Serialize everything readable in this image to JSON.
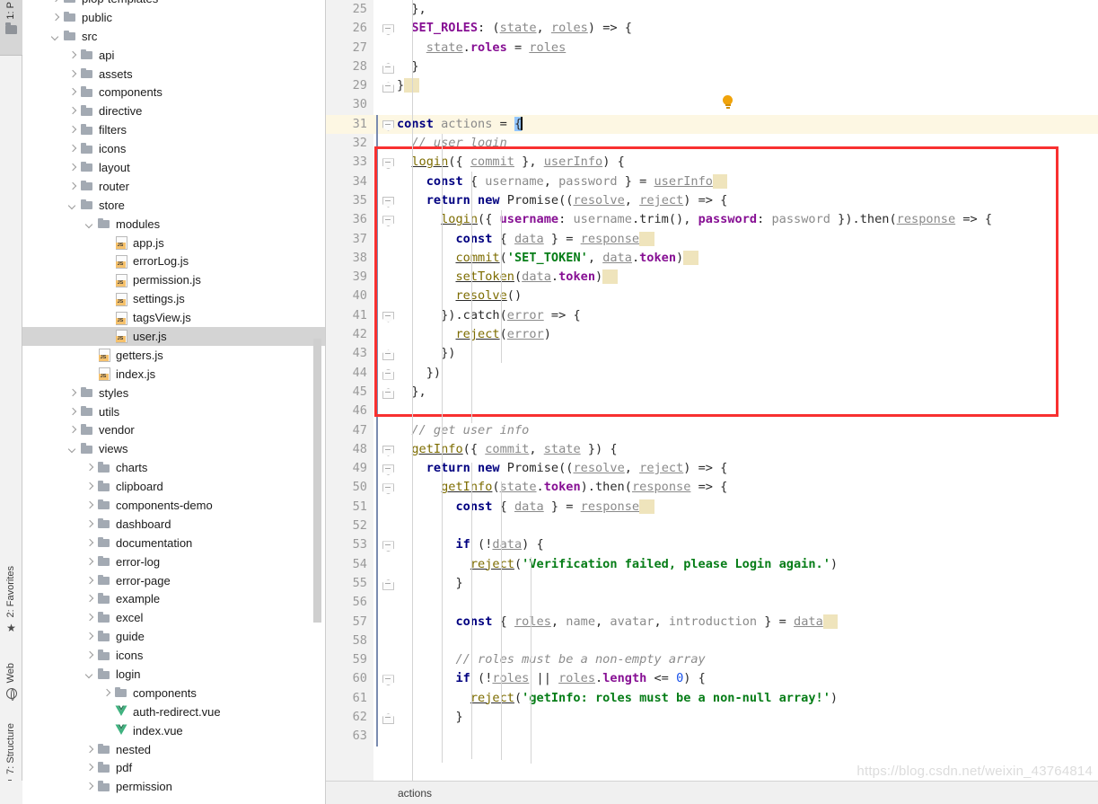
{
  "toolbar": {
    "project_label": "1: P",
    "favorites_label": "2: Favorites",
    "web_label": "Web",
    "structure_label": "7: Structure"
  },
  "project_tree": {
    "items": [
      {
        "label": "plop-templates",
        "type": "folder",
        "arrow": "right",
        "depth": 1,
        "selected": false,
        "cut": true
      },
      {
        "label": "public",
        "type": "folder",
        "arrow": "right",
        "depth": 1,
        "selected": false
      },
      {
        "label": "src",
        "type": "folder",
        "arrow": "down",
        "depth": 1,
        "selected": false
      },
      {
        "label": "api",
        "type": "folder",
        "arrow": "right",
        "depth": 2,
        "selected": false
      },
      {
        "label": "assets",
        "type": "folder",
        "arrow": "right",
        "depth": 2,
        "selected": false
      },
      {
        "label": "components",
        "type": "folder",
        "arrow": "right",
        "depth": 2,
        "selected": false
      },
      {
        "label": "directive",
        "type": "folder",
        "arrow": "right",
        "depth": 2,
        "selected": false
      },
      {
        "label": "filters",
        "type": "folder",
        "arrow": "right",
        "depth": 2,
        "selected": false
      },
      {
        "label": "icons",
        "type": "folder",
        "arrow": "right",
        "depth": 2,
        "selected": false
      },
      {
        "label": "layout",
        "type": "folder",
        "arrow": "right",
        "depth": 2,
        "selected": false
      },
      {
        "label": "router",
        "type": "folder",
        "arrow": "right",
        "depth": 2,
        "selected": false
      },
      {
        "label": "store",
        "type": "folder",
        "arrow": "down",
        "depth": 2,
        "selected": false
      },
      {
        "label": "modules",
        "type": "folder",
        "arrow": "down",
        "depth": 3,
        "selected": false
      },
      {
        "label": "app.js",
        "type": "js",
        "arrow": "none",
        "depth": 4,
        "selected": false
      },
      {
        "label": "errorLog.js",
        "type": "js",
        "arrow": "none",
        "depth": 4,
        "selected": false
      },
      {
        "label": "permission.js",
        "type": "js",
        "arrow": "none",
        "depth": 4,
        "selected": false
      },
      {
        "label": "settings.js",
        "type": "js",
        "arrow": "none",
        "depth": 4,
        "selected": false
      },
      {
        "label": "tagsView.js",
        "type": "js",
        "arrow": "none",
        "depth": 4,
        "selected": false
      },
      {
        "label": "user.js",
        "type": "js",
        "arrow": "none",
        "depth": 4,
        "selected": true
      },
      {
        "label": "getters.js",
        "type": "js",
        "arrow": "none",
        "depth": 3,
        "selected": false
      },
      {
        "label": "index.js",
        "type": "js",
        "arrow": "none",
        "depth": 3,
        "selected": false
      },
      {
        "label": "styles",
        "type": "folder",
        "arrow": "right",
        "depth": 2,
        "selected": false
      },
      {
        "label": "utils",
        "type": "folder",
        "arrow": "right",
        "depth": 2,
        "selected": false
      },
      {
        "label": "vendor",
        "type": "folder",
        "arrow": "right",
        "depth": 2,
        "selected": false
      },
      {
        "label": "views",
        "type": "folder",
        "arrow": "down",
        "depth": 2,
        "selected": false
      },
      {
        "label": "charts",
        "type": "folder",
        "arrow": "right",
        "depth": 3,
        "selected": false
      },
      {
        "label": "clipboard",
        "type": "folder",
        "arrow": "right",
        "depth": 3,
        "selected": false
      },
      {
        "label": "components-demo",
        "type": "folder",
        "arrow": "right",
        "depth": 3,
        "selected": false
      },
      {
        "label": "dashboard",
        "type": "folder",
        "arrow": "right",
        "depth": 3,
        "selected": false
      },
      {
        "label": "documentation",
        "type": "folder",
        "arrow": "right",
        "depth": 3,
        "selected": false
      },
      {
        "label": "error-log",
        "type": "folder",
        "arrow": "right",
        "depth": 3,
        "selected": false
      },
      {
        "label": "error-page",
        "type": "folder",
        "arrow": "right",
        "depth": 3,
        "selected": false
      },
      {
        "label": "example",
        "type": "folder",
        "arrow": "right",
        "depth": 3,
        "selected": false
      },
      {
        "label": "excel",
        "type": "folder",
        "arrow": "right",
        "depth": 3,
        "selected": false
      },
      {
        "label": "guide",
        "type": "folder",
        "arrow": "right",
        "depth": 3,
        "selected": false
      },
      {
        "label": "icons",
        "type": "folder",
        "arrow": "right",
        "depth": 3,
        "selected": false
      },
      {
        "label": "login",
        "type": "folder",
        "arrow": "down",
        "depth": 3,
        "selected": false
      },
      {
        "label": "components",
        "type": "folder",
        "arrow": "right",
        "depth": 4,
        "selected": false
      },
      {
        "label": "auth-redirect.vue",
        "type": "vue",
        "arrow": "none",
        "depth": 4,
        "selected": false
      },
      {
        "label": "index.vue",
        "type": "vue",
        "arrow": "none",
        "depth": 4,
        "selected": false
      },
      {
        "label": "nested",
        "type": "folder",
        "arrow": "right",
        "depth": 3,
        "selected": false
      },
      {
        "label": "pdf",
        "type": "folder",
        "arrow": "right",
        "depth": 3,
        "selected": false
      },
      {
        "label": "permission",
        "type": "folder",
        "arrow": "right",
        "depth": 3,
        "selected": false
      }
    ]
  },
  "editor": {
    "first_line_number": 25,
    "highlighted_line": 31,
    "breadcrumb": "actions",
    "watermark": "https://blog.csdn.net/weixin_43764814",
    "lines": [
      {
        "n": 25,
        "text": "  },"
      },
      {
        "n": 26,
        "text": "  SET_ROLES: (state, roles) => {"
      },
      {
        "n": 27,
        "text": "    state.roles = roles"
      },
      {
        "n": 28,
        "text": "  }"
      },
      {
        "n": 29,
        "text": "}"
      },
      {
        "n": 30,
        "text": ""
      },
      {
        "n": 31,
        "text": "const actions = {"
      },
      {
        "n": 32,
        "text": "  // user login"
      },
      {
        "n": 33,
        "text": "  login({ commit }, userInfo) {"
      },
      {
        "n": 34,
        "text": "    const { username, password } = userInfo"
      },
      {
        "n": 35,
        "text": "    return new Promise((resolve, reject) => {"
      },
      {
        "n": 36,
        "text": "      login({ username: username.trim(), password: password }).then(response => {"
      },
      {
        "n": 37,
        "text": "        const { data } = response"
      },
      {
        "n": 38,
        "text": "        commit('SET_TOKEN', data.token)"
      },
      {
        "n": 39,
        "text": "        setToken(data.token)"
      },
      {
        "n": 40,
        "text": "        resolve()"
      },
      {
        "n": 41,
        "text": "      }).catch(error => {"
      },
      {
        "n": 42,
        "text": "        reject(error)"
      },
      {
        "n": 43,
        "text": "      })"
      },
      {
        "n": 44,
        "text": "    })"
      },
      {
        "n": 45,
        "text": "  },"
      },
      {
        "n": 46,
        "text": ""
      },
      {
        "n": 47,
        "text": "  // get user info"
      },
      {
        "n": 48,
        "text": "  getInfo({ commit, state }) {"
      },
      {
        "n": 49,
        "text": "    return new Promise((resolve, reject) => {"
      },
      {
        "n": 50,
        "text": "      getInfo(state.token).then(response => {"
      },
      {
        "n": 51,
        "text": "        const { data } = response"
      },
      {
        "n": 52,
        "text": ""
      },
      {
        "n": 53,
        "text": "        if (!data) {"
      },
      {
        "n": 54,
        "text": "          reject('Verification failed, please Login again.')"
      },
      {
        "n": 55,
        "text": "        }"
      },
      {
        "n": 56,
        "text": ""
      },
      {
        "n": 57,
        "text": "        const { roles, name, avatar, introduction } = data"
      },
      {
        "n": 58,
        "text": ""
      },
      {
        "n": 59,
        "text": "        // roles must be a non-empty array"
      },
      {
        "n": 60,
        "text": "        if (!roles || roles.length <= 0) {"
      },
      {
        "n": 61,
        "text": "          reject('getInfo: roles must be a non-null array!')"
      },
      {
        "n": 62,
        "text": "        }"
      },
      {
        "n": 63,
        "text": ""
      }
    ]
  },
  "annotation": {
    "red_box_label": "highlight-rectangle"
  },
  "colors": {
    "keyword": "#000080",
    "string": "#067d17",
    "comment": "#8c8c8c",
    "property": "#871094",
    "function": "#7d6c00",
    "number": "#1750eb",
    "accent_red": "#f83030",
    "line_highlight": "#fdf7e3",
    "warning_highlight": "#efe4bc"
  }
}
